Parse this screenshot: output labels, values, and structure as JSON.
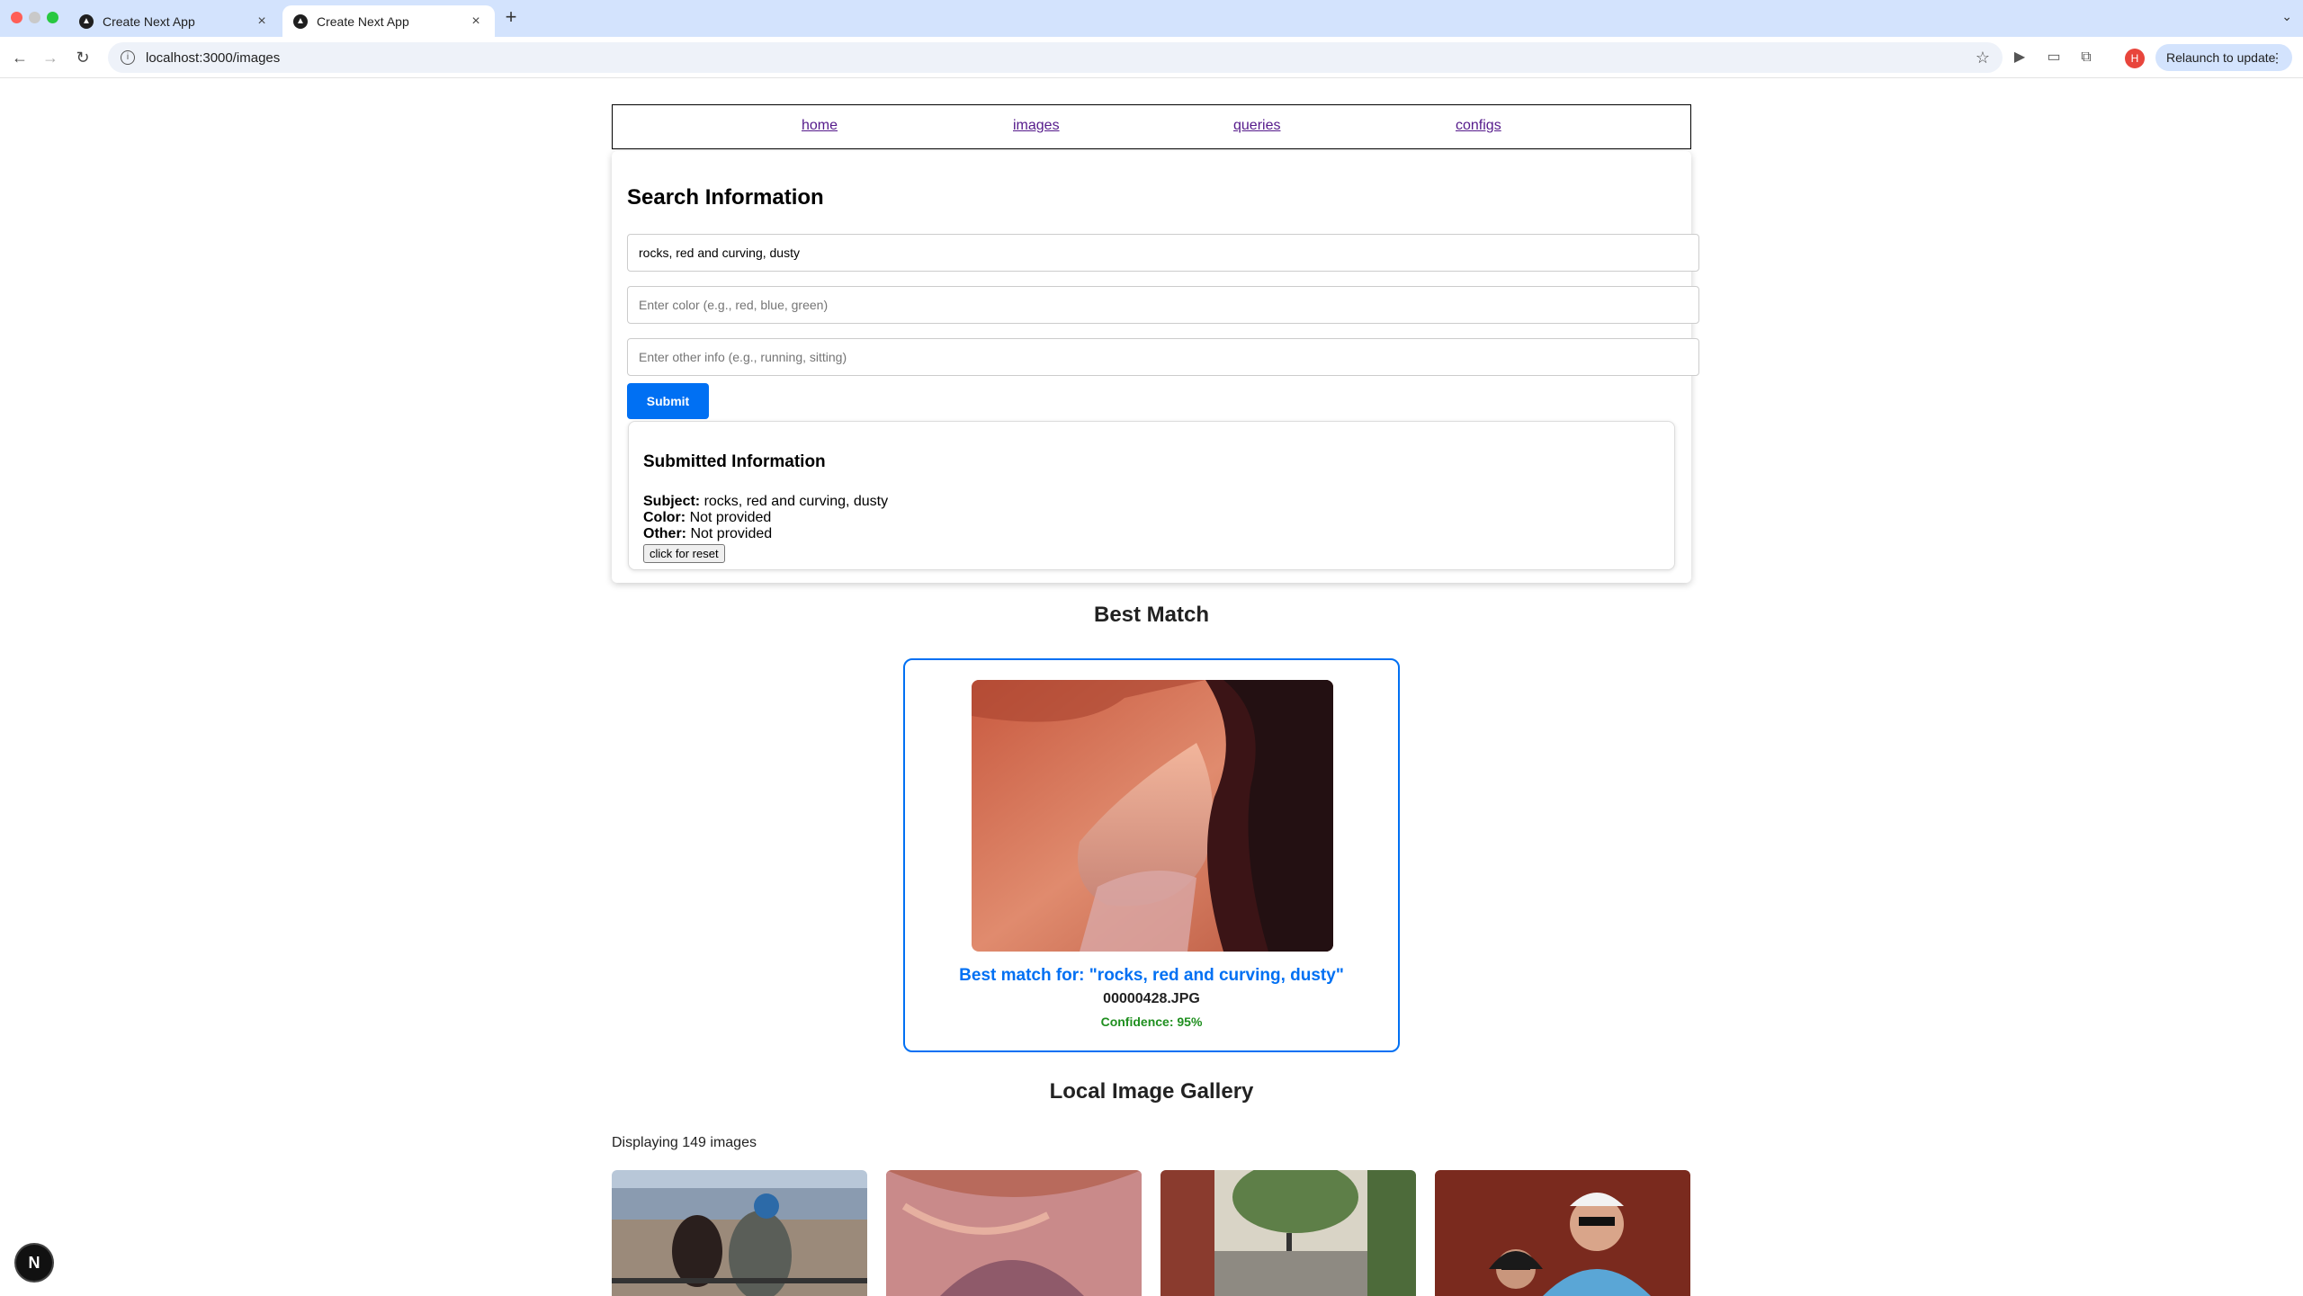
{
  "browser": {
    "tabs": [
      {
        "title": "Create Next App",
        "active": false
      },
      {
        "title": "Create Next App",
        "active": true
      }
    ],
    "url": "localhost:3000/images",
    "profile_initial": "H",
    "relaunch_label": "Relaunch to update"
  },
  "nav": {
    "home": "home",
    "images": "images",
    "queries": "queries",
    "configs": "configs"
  },
  "search": {
    "title": "Search Information",
    "subject_value": "rocks, red and curving, dusty",
    "color_placeholder": "Enter color (e.g., red, blue, green)",
    "other_placeholder": "Enter other info (e.g., running, sitting)",
    "submit_label": "Submit"
  },
  "submitted": {
    "title": "Submitted Information",
    "subject_label": "Subject:",
    "subject_value": "rocks, red and curving, dusty",
    "color_label": "Color:",
    "color_value": "Not provided",
    "other_label": "Other:",
    "other_value": "Not provided",
    "reset_label": "click for reset"
  },
  "best_match": {
    "heading": "Best Match",
    "caption": "Best match for: \"rocks, red and curving, dusty\"",
    "filename": "00000428.JPG",
    "confidence": "Confidence: 95%"
  },
  "gallery": {
    "heading": "Local Image Gallery",
    "count_text": "Displaying 149 images"
  },
  "next_badge": "N",
  "colors": {
    "accent": "#0070f3",
    "confidence": "#1f8f1f",
    "link": "#551a8b",
    "tabbar": "#d3e3fd"
  }
}
